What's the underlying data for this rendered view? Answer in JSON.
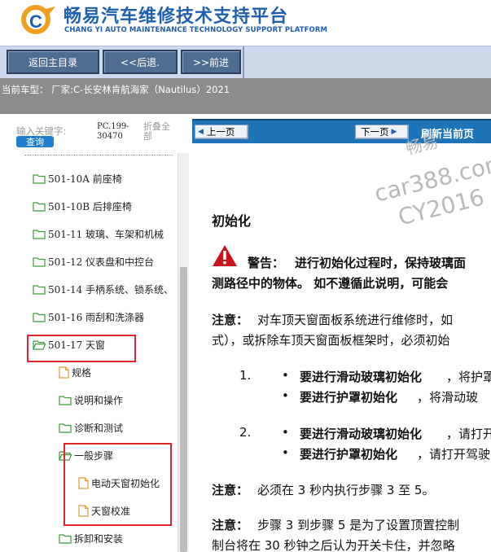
{
  "header": {
    "title": "畅易汽车维修技术支持平台",
    "subtitle": "CHANG YI AUTO MAINTENANCE TECHNOLOGY SUPPORT PLATFORM",
    "brand_color": "#1f5fb0"
  },
  "toolbar": {
    "home_label": "返回主目录",
    "back_label": "<<后退.",
    "forward_label": ">>前进"
  },
  "vehicle": {
    "text": "当前车型：  厂家:C-长安林肯航海家（Nautilus）2021"
  },
  "search": {
    "keyword_label": "输入关键字:",
    "search_label": "查询",
    "code": "PC.199-30470",
    "collapse_label": "折叠全部"
  },
  "tree": {
    "items": [
      {
        "label": "501-10A 前座椅",
        "icon": "folder-icon"
      },
      {
        "label": "501-10B 后排座椅",
        "icon": "folder-icon"
      },
      {
        "label": "501-11 玻璃、车架和机械",
        "icon": "folder-icon"
      },
      {
        "label": "501-12 仪表盘和中控台",
        "icon": "folder-icon"
      },
      {
        "label": "501-14 手柄系统、锁系统、",
        "icon": "folder-icon"
      },
      {
        "label": "501-16 雨刮和洗涤器",
        "icon": "folder-icon"
      },
      {
        "label": "501-17 天窗",
        "icon": "folder-open-icon"
      },
      {
        "label": "规格",
        "icon": "document-icon"
      },
      {
        "label": "说明和操作",
        "icon": "folder-icon"
      },
      {
        "label": "诊断和测试",
        "icon": "folder-icon"
      },
      {
        "label": "一般步骤",
        "icon": "folder-open-icon"
      },
      {
        "label": "电动天窗初始化",
        "icon": "document-icon"
      },
      {
        "label": "天窗校准",
        "icon": "document-icon"
      },
      {
        "label": "拆卸和安装",
        "icon": "folder-icon"
      }
    ]
  },
  "nav": {
    "prev_label": "上一页",
    "next_label": "下一页",
    "refresh_label": "刷新当前页"
  },
  "watermark": {
    "line1": "畅易",
    "line2": "car388.com",
    "line3": "CY2016"
  },
  "content": {
    "heading": "初始化",
    "warning_label": "警告：",
    "warning_line1": "进行初始化过程时，保持玻璃面",
    "warning_line2": "测路径中的物体。 如不遵循此说明，可能会",
    "note1_label": "注意：",
    "note1_line1": "对车顶天窗面板系统进行维修时，如",
    "note1_line2": "式），或拆除车顶天窗面板框架时，必须初始",
    "step1_num": "1.",
    "step1_a_bold": "要进行滑动玻璃初始化",
    "step1_a_rest": "，将护罩",
    "step1_b_bold": "要进行护罩初始化",
    "step1_b_rest": "，将滑动玻",
    "step2_num": "2.",
    "step2_a_bold": "要进行滑动玻璃初始化",
    "step2_a_rest": "，请打开",
    "step2_b_bold": "要进行护罩初始化",
    "step2_b_rest": "，请打开驾驶",
    "note2_label": "注意：",
    "note2_text": "必须在 3 秒内执行步骤 3 至 5。",
    "note3_label": "注意：",
    "note3_line1": "步骤 3 到步骤 5 是为了设置顶置控制",
    "note3_line2": "制台将在 30 秒钟之后认为开关卡住，并忽略"
  },
  "colors": {
    "toolbar_bg": "#cfd9ec",
    "button_bg": "#4f6d91",
    "car_bar": "#8c8c8c",
    "nav_bar": "#1f74b8",
    "highlight": "#e0262b",
    "warning": "#c8141a"
  }
}
